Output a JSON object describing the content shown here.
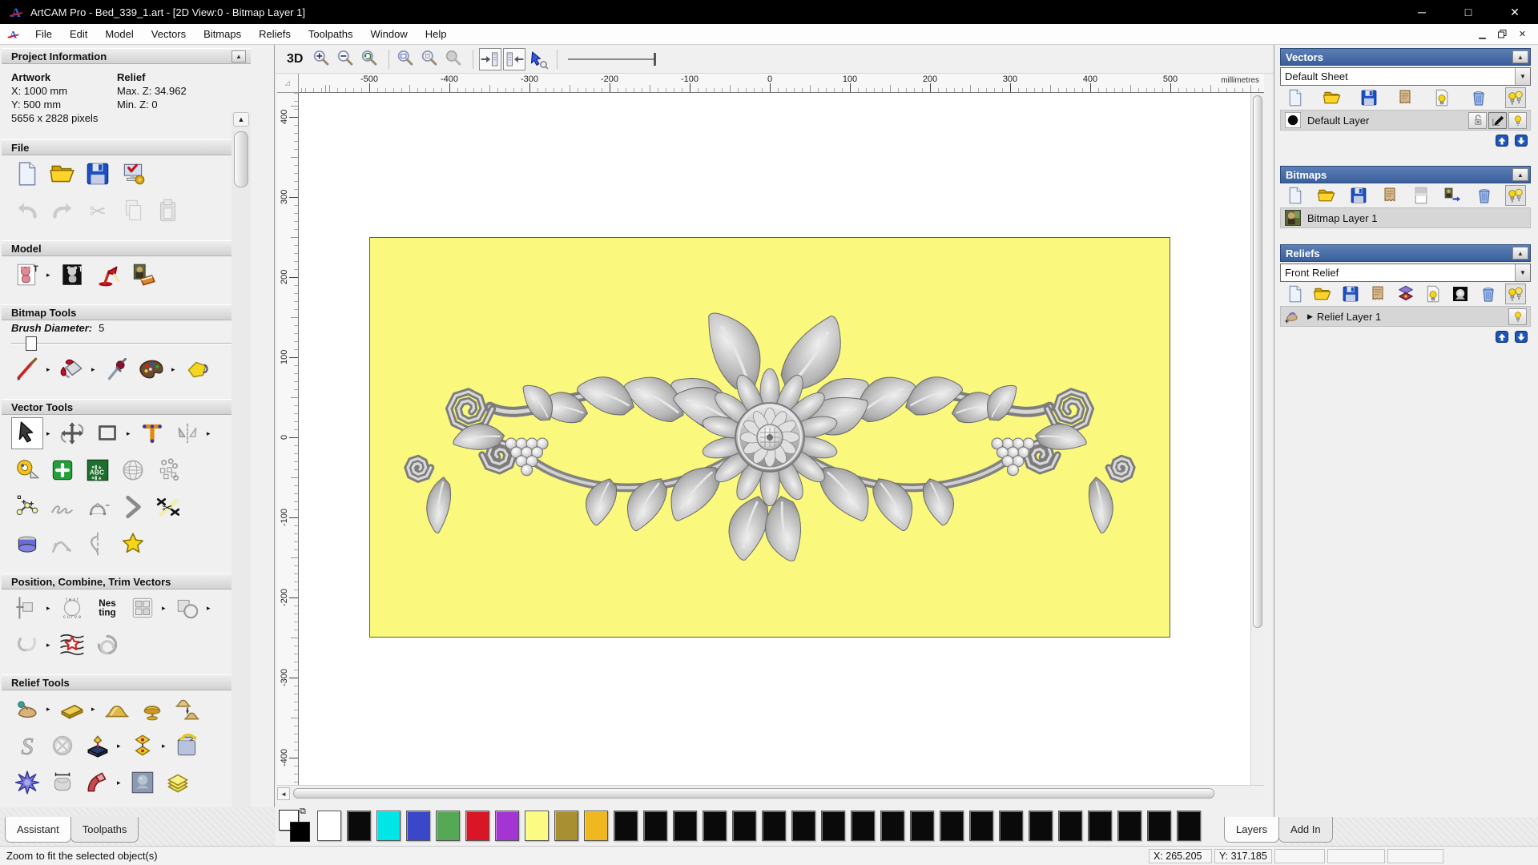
{
  "window": {
    "title": "ArtCAM Pro - Bed_339_1.art - [2D View:0 - Bitmap Layer 1]"
  },
  "menu": {
    "items": [
      "File",
      "Edit",
      "Model",
      "Vectors",
      "Bitmaps",
      "Reliefs",
      "Toolpaths",
      "Window",
      "Help"
    ]
  },
  "left_panel": {
    "tabs": [
      "Assistant",
      "Toolpaths"
    ],
    "project_info": {
      "artwork_label": "Artwork",
      "artwork_x": "X: 1000 mm",
      "artwork_y": "Y: 500 mm",
      "relief_label": "Relief",
      "relief_max": "Max. Z: 34.962",
      "relief_min": "Min. Z: 0",
      "pixels": "5656 x 2828 pixels"
    },
    "bitmap_tools": {
      "brush_label": "Brush Diameter:",
      "brush_value": "5"
    },
    "sections": [
      {
        "id": "project-information",
        "title": "Project Information",
        "info": true
      },
      {
        "id": "file",
        "title": "File",
        "rows": [
          [
            {
              "n": "new-document"
            },
            {
              "n": "open-file"
            },
            {
              "n": "save-file"
            },
            {
              "n": "model-setup"
            }
          ],
          [
            {
              "n": "undo",
              "d": 1
            },
            {
              "n": "redo",
              "d": 1
            },
            {
              "n": "cut",
              "d": 1
            },
            {
              "n": "copy",
              "d": 1
            },
            {
              "n": "paste",
              "d": 1
            }
          ]
        ]
      },
      {
        "id": "model",
        "title": "Model",
        "rows": [
          [
            {
              "n": "model-size",
              "f": 1
            },
            {
              "n": "greyscale-model"
            },
            {
              "n": "lighting"
            },
            {
              "n": "load-picture"
            }
          ]
        ]
      },
      {
        "id": "bitmap-tools",
        "title": "Bitmap Tools",
        "slider": true,
        "rows": [
          [
            {
              "n": "paint-brush",
              "f": 1
            },
            {
              "n": "flood-fill",
              "f": 1
            },
            {
              "n": "colour-picker"
            },
            {
              "n": "palette-tool",
              "f": 1
            },
            {
              "n": "erase-tool"
            }
          ]
        ]
      },
      {
        "id": "vector-tools",
        "title": "Vector Tools",
        "rows": [
          [
            {
              "n": "select-tool",
              "a": 1,
              "f": 1
            },
            {
              "n": "transform-tool"
            },
            {
              "n": "create-rectangle",
              "f": 1
            },
            {
              "n": "create-text"
            },
            {
              "n": "mirror-tool",
              "f": 1
            }
          ],
          [
            {
              "n": "measure-tool"
            },
            {
              "n": "node-editing"
            },
            {
              "n": "text-abc"
            },
            {
              "n": "wire-grid"
            },
            {
              "n": "array-dots"
            }
          ],
          [
            {
              "n": "create-polyline"
            },
            {
              "n": "freehand-draw"
            },
            {
              "n": "bezier-curve"
            },
            {
              "n": "fillet-corner"
            },
            {
              "n": "trim-vectors"
            }
          ],
          [
            {
              "n": "dome-tool"
            },
            {
              "n": "curve-arrows"
            },
            {
              "n": "section-profile"
            },
            {
              "n": "star-yellow"
            }
          ]
        ]
      },
      {
        "id": "position-combine",
        "title": "Position, Combine, Trim Vectors",
        "rows": [
          [
            {
              "n": "align-objects",
              "f": 1
            },
            {
              "n": "text-on-curve"
            },
            {
              "n": "nesting"
            },
            {
              "n": "block-array",
              "f": 1
            },
            {
              "n": "weld-vectors",
              "f": 1
            }
          ],
          [
            {
              "n": "join-vectors",
              "f": 1
            },
            {
              "n": "fit-curves"
            },
            {
              "n": "spiral-tool"
            }
          ]
        ]
      },
      {
        "id": "relief-tools",
        "title": "Relief Tools",
        "rows": [
          [
            {
              "n": "relief-hand",
              "f": 1
            },
            {
              "n": "gold-bar",
              "f": 1
            },
            {
              "n": "mound-smooth"
            },
            {
              "n": "mound-dome"
            },
            {
              "n": "mound-pair"
            }
          ],
          [
            {
              "n": "sculpt-s"
            },
            {
              "n": "weave-knot"
            },
            {
              "n": "stamp-relief",
              "f": 1
            },
            {
              "n": "offset-relief",
              "f": 1
            },
            {
              "n": "flip-relief"
            }
          ],
          [
            {
              "n": "star-blue"
            },
            {
              "n": "pillow-relief"
            },
            {
              "n": "fan-relief",
              "f": 1
            },
            {
              "n": "emboss-relief"
            },
            {
              "n": "pages-relief"
            }
          ],
          [
            {
              "n": "partial-red"
            },
            {
              "n": "partial-grid"
            },
            {
              "n": "partial-blue"
            },
            {
              "n": "partial-pages"
            }
          ]
        ]
      }
    ]
  },
  "toolbar2d": {
    "view_label": "3D",
    "icons": [
      "zoom-in",
      "zoom-out",
      "zoom-previous",
      "sep",
      "zoom-box",
      "zoom-drawing",
      "zoom-selected",
      "sep",
      "pan-left",
      "pan-right",
      "view-cursor",
      "sep"
    ]
  },
  "rulers": {
    "unit": "millimetres",
    "h_ticks": [
      -500,
      -400,
      -300,
      -200,
      -100,
      0,
      100,
      200,
      300,
      400,
      500
    ],
    "v_ticks": [
      400,
      300,
      200,
      100,
      0,
      -100,
      -200,
      -300,
      -400
    ]
  },
  "canvas": {
    "sheet_color": "#faf87d",
    "artwork": "grayscale floral acanthus relief ornament with central rosette flower, scrolling leaves and grape clusters"
  },
  "palette": {
    "fg": "#ffffff",
    "bg": "#000000",
    "swatches": [
      "#ffffff",
      "#0a0a0a",
      "#00e6e6",
      "#3947c8",
      "#55a855",
      "#d81626",
      "#a435d2",
      "#fbfb84",
      "#a89032",
      "#f0b81e",
      "#0a0a0a",
      "#0a0a0a",
      "#0a0a0a",
      "#0a0a0a",
      "#0a0a0a",
      "#0a0a0a",
      "#0a0a0a",
      "#0a0a0a",
      "#0a0a0a",
      "#0a0a0a",
      "#0a0a0a",
      "#0a0a0a",
      "#0a0a0a",
      "#0a0a0a",
      "#0a0a0a",
      "#0a0a0a",
      "#0a0a0a",
      "#0a0a0a",
      "#0a0a0a",
      "#0a0a0a"
    ]
  },
  "right_panel": {
    "tabs": [
      "Layers",
      "Add In"
    ],
    "vectors": {
      "title": "Vectors",
      "sheet": "Default Sheet",
      "toolbar": [
        "new-document",
        "open-file",
        "save-file",
        "merge-tan",
        "bulb-page",
        "trash",
        "bulbs-all"
      ],
      "layer": {
        "name": "Default Layer",
        "color": "#000000",
        "controls": [
          "lock-open",
          "snap-pen",
          "bulb"
        ]
      }
    },
    "bitmaps": {
      "title": "Bitmaps",
      "toolbar": [
        "new-document",
        "open-file",
        "save-file",
        "merge-tan",
        "fade-page",
        "mona-move",
        "trash",
        "bulbs-all"
      ],
      "layer": {
        "name": "Bitmap Layer 1"
      }
    },
    "reliefs": {
      "title": "Reliefs",
      "selected": "Front Relief",
      "toolbar": [
        "new-document",
        "open-file",
        "save-file",
        "merge-tan",
        "layers-purple",
        "bulb-page",
        "relief-bw",
        "trash",
        "bulbs-all"
      ],
      "layer": {
        "name": "Relief Layer 1",
        "controls": [
          "bulb"
        ]
      }
    }
  },
  "status_bar": {
    "message": "Zoom to fit the selected object(s)",
    "x": "X: 265.205",
    "y": "Y: 317.185"
  }
}
